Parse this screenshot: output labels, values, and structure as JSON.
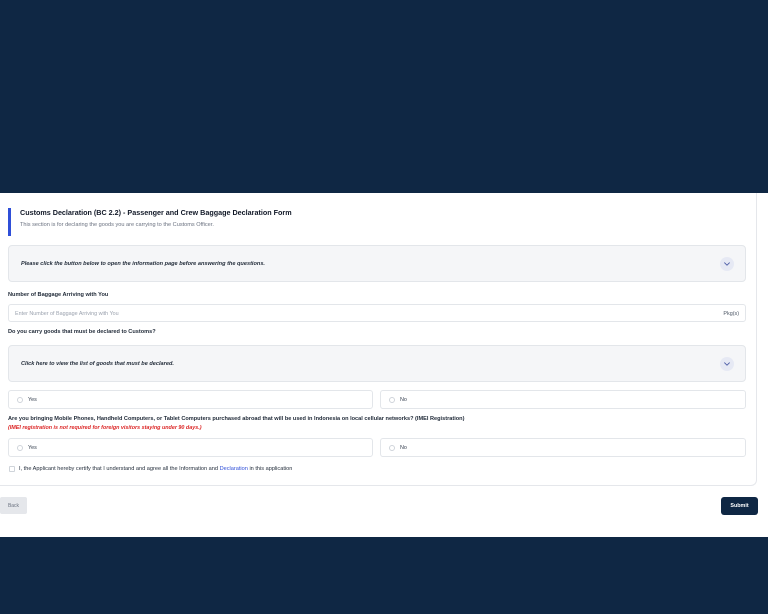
{
  "form": {
    "title": "Customs Declaration (BC 2.2) - Passenger and Crew Baggage Declaration Form",
    "subtitle": "This section is for declaring the goods you are carrying to the Customs Officer.",
    "info_accordion_text": "Please click the button below to open the information page before answering the questions.",
    "baggage": {
      "label": "Number of Baggage Arriving with You",
      "placeholder": "Enter Number of Baggage Arriving with You",
      "suffix": "Pkg(s)"
    },
    "declare_goods": {
      "question": "Do you carry goods that must be declared to Customs?",
      "accordion_text": "Click here to view the list of goods that must be declared.",
      "options": [
        "Yes",
        "No"
      ]
    },
    "imei": {
      "question": "Are you bringing Mobile Phones, Handheld Computers, or Tablet Computers purchased abroad that will be used in Indonesia on local cellular networks? (IMEI Registration)",
      "note": "(IMEI registration is not required for foreign visitors staying under 90 days.)",
      "options": [
        "Yes",
        "No"
      ]
    },
    "certify": {
      "text_before": "I, the Applicant hereby certify that I understand and agree all the Information and",
      "link": "Declaration",
      "text_after": "in this application"
    }
  },
  "actions": {
    "back_label": "Back",
    "submit_label": "Submit"
  },
  "colors": {
    "page_background": "#0f2744",
    "accent": "#2f4fd8",
    "submit_button": "#0f2744",
    "note_red": "#dc2626"
  },
  "icons": {
    "accordion_toggle": "chevron-down-icon"
  }
}
